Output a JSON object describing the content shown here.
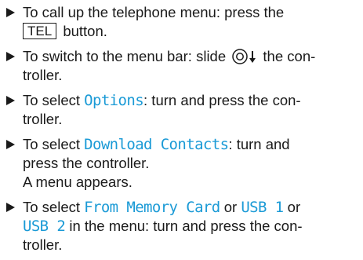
{
  "steps": [
    {
      "line1_pre": "To call up the telephone menu: press the",
      "key": "TEL",
      "line2_post": " button."
    },
    {
      "pre": "To switch to the menu bar: slide ",
      "post_line1": " the con-",
      "line2": "troller.",
      "icon": "controller-slide-down-icon"
    },
    {
      "pre": "To select ",
      "menu_item": "Options",
      "post_line1": ": turn and press the con-",
      "line2": "troller."
    },
    {
      "pre": "To select ",
      "menu_item": "Download Contacts",
      "post_line1": ": turn and",
      "line2": "press the controller.",
      "line3": "A menu appears."
    },
    {
      "pre": "To select ",
      "menu_item_a": "From Memory Card",
      "mid1": " or ",
      "menu_item_b": "USB 1",
      "mid2": " or",
      "menu_item_c": "USB 2",
      "post_line2": " in the menu: turn and press the con-",
      "line3": "troller."
    }
  ],
  "colors": {
    "menu_text": "#1a9ad6",
    "body_text": "#1a1a1a"
  }
}
